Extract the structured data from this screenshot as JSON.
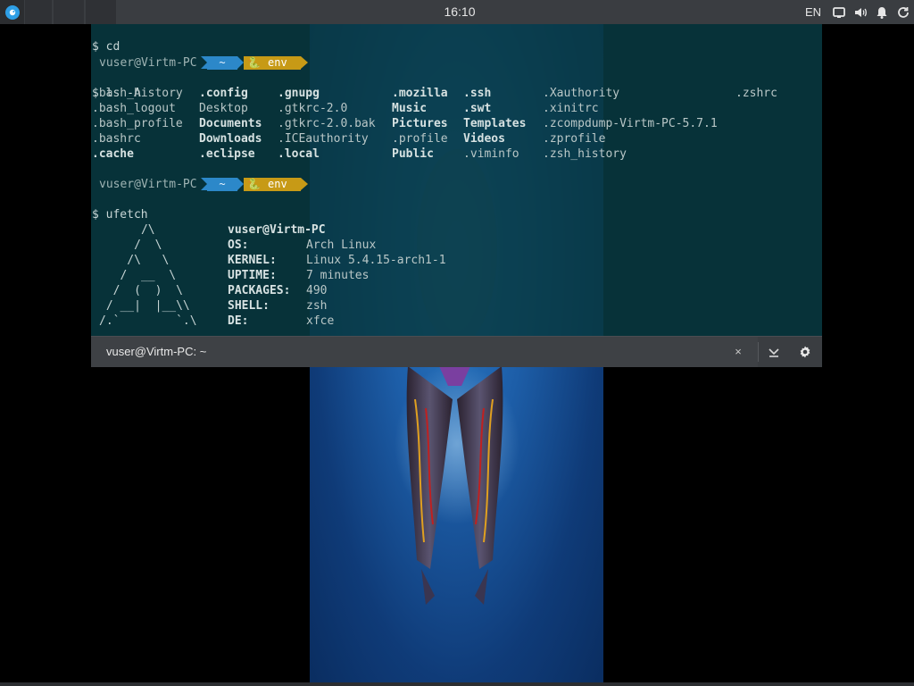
{
  "panel": {
    "clock": "16:10",
    "language": "EN",
    "icons": [
      "start-menu-icon",
      "display-icon",
      "volume-icon",
      "notifications-icon",
      "update-icon"
    ]
  },
  "terminal": {
    "line_cd": "$ cd",
    "prompt1": {
      "user": "vuser@Virtm-PC",
      "dir": "~",
      "env": "env"
    },
    "cmd_ls": "$ ls -A",
    "ls_rows": [
      [
        ".bash_history",
        ".config",
        ".gnupg",
        ".mozilla",
        ".ssh",
        ".Xauthority",
        ".zshrc"
      ],
      [
        ".bash_logout",
        "Desktop",
        ".gtkrc-2.0",
        "Music",
        ".swt",
        ".xinitrc",
        ""
      ],
      [
        ".bash_profile",
        "Documents",
        ".gtkrc-2.0.bak",
        "Pictures",
        "Templates",
        ".zcompdump-Virtm-PC-5.7.1",
        ""
      ],
      [
        ".bashrc",
        "Downloads",
        ".ICEauthority",
        ".profile",
        "Videos",
        ".zprofile",
        ""
      ],
      [
        ".cache",
        ".eclipse",
        ".local",
        "Public",
        ".viminfo",
        ".zsh_history",
        ""
      ]
    ],
    "prompt2": {
      "user": "vuser@Virtm-PC",
      "dir": "~",
      "env": "env"
    },
    "cmd_ufetch": "$ ufetch",
    "ufetch": {
      "art": [
        "      /\\",
        "     /  \\",
        "    /\\   \\",
        "   /  __  \\",
        "  /  (  )  \\",
        " / __|  |__\\\\",
        "/.`        `.\\"
      ],
      "header": "vuser@Virtm-PC",
      "fields": [
        {
          "key": "OS:",
          "value": "Arch Linux"
        },
        {
          "key": "KERNEL:",
          "value": "Linux 5.4.15-arch1-1"
        },
        {
          "key": "UPTIME:",
          "value": "7 minutes"
        },
        {
          "key": "PACKAGES:",
          "value": "490"
        },
        {
          "key": "SHELL:",
          "value": "zsh"
        },
        {
          "key": "DE:",
          "value": "xfce"
        }
      ]
    },
    "tab_title": "vuser@Virtm-PC: ~",
    "tab_close": "×"
  },
  "colors": {
    "panel_bg": "#3a3d41",
    "terminal_bg": "#083a42",
    "prompt_dir": "#2c88c9",
    "prompt_env": "#c79a16",
    "wallpaper": "#1d5ea8"
  }
}
